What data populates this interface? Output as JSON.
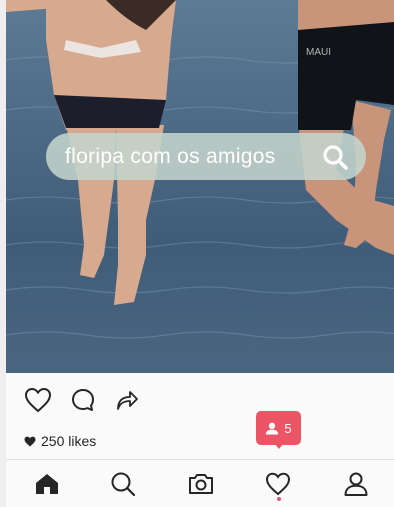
{
  "search": {
    "text": "floripa com os amigos",
    "icon": "search-icon"
  },
  "post": {
    "likes_text": "250 likes",
    "actions": [
      "like-icon",
      "comment-icon",
      "share-icon"
    ]
  },
  "notification_badge": {
    "icon": "user-icon",
    "count": "5"
  },
  "tabbar": {
    "tabs": [
      "home-tab",
      "search-tab",
      "camera-tab",
      "activity-tab",
      "profile-tab"
    ],
    "active_dot_under": "activity-tab"
  },
  "colors": {
    "accent": "#ec5565",
    "search_pill": "#c4d4cb",
    "icon": "#262626"
  }
}
